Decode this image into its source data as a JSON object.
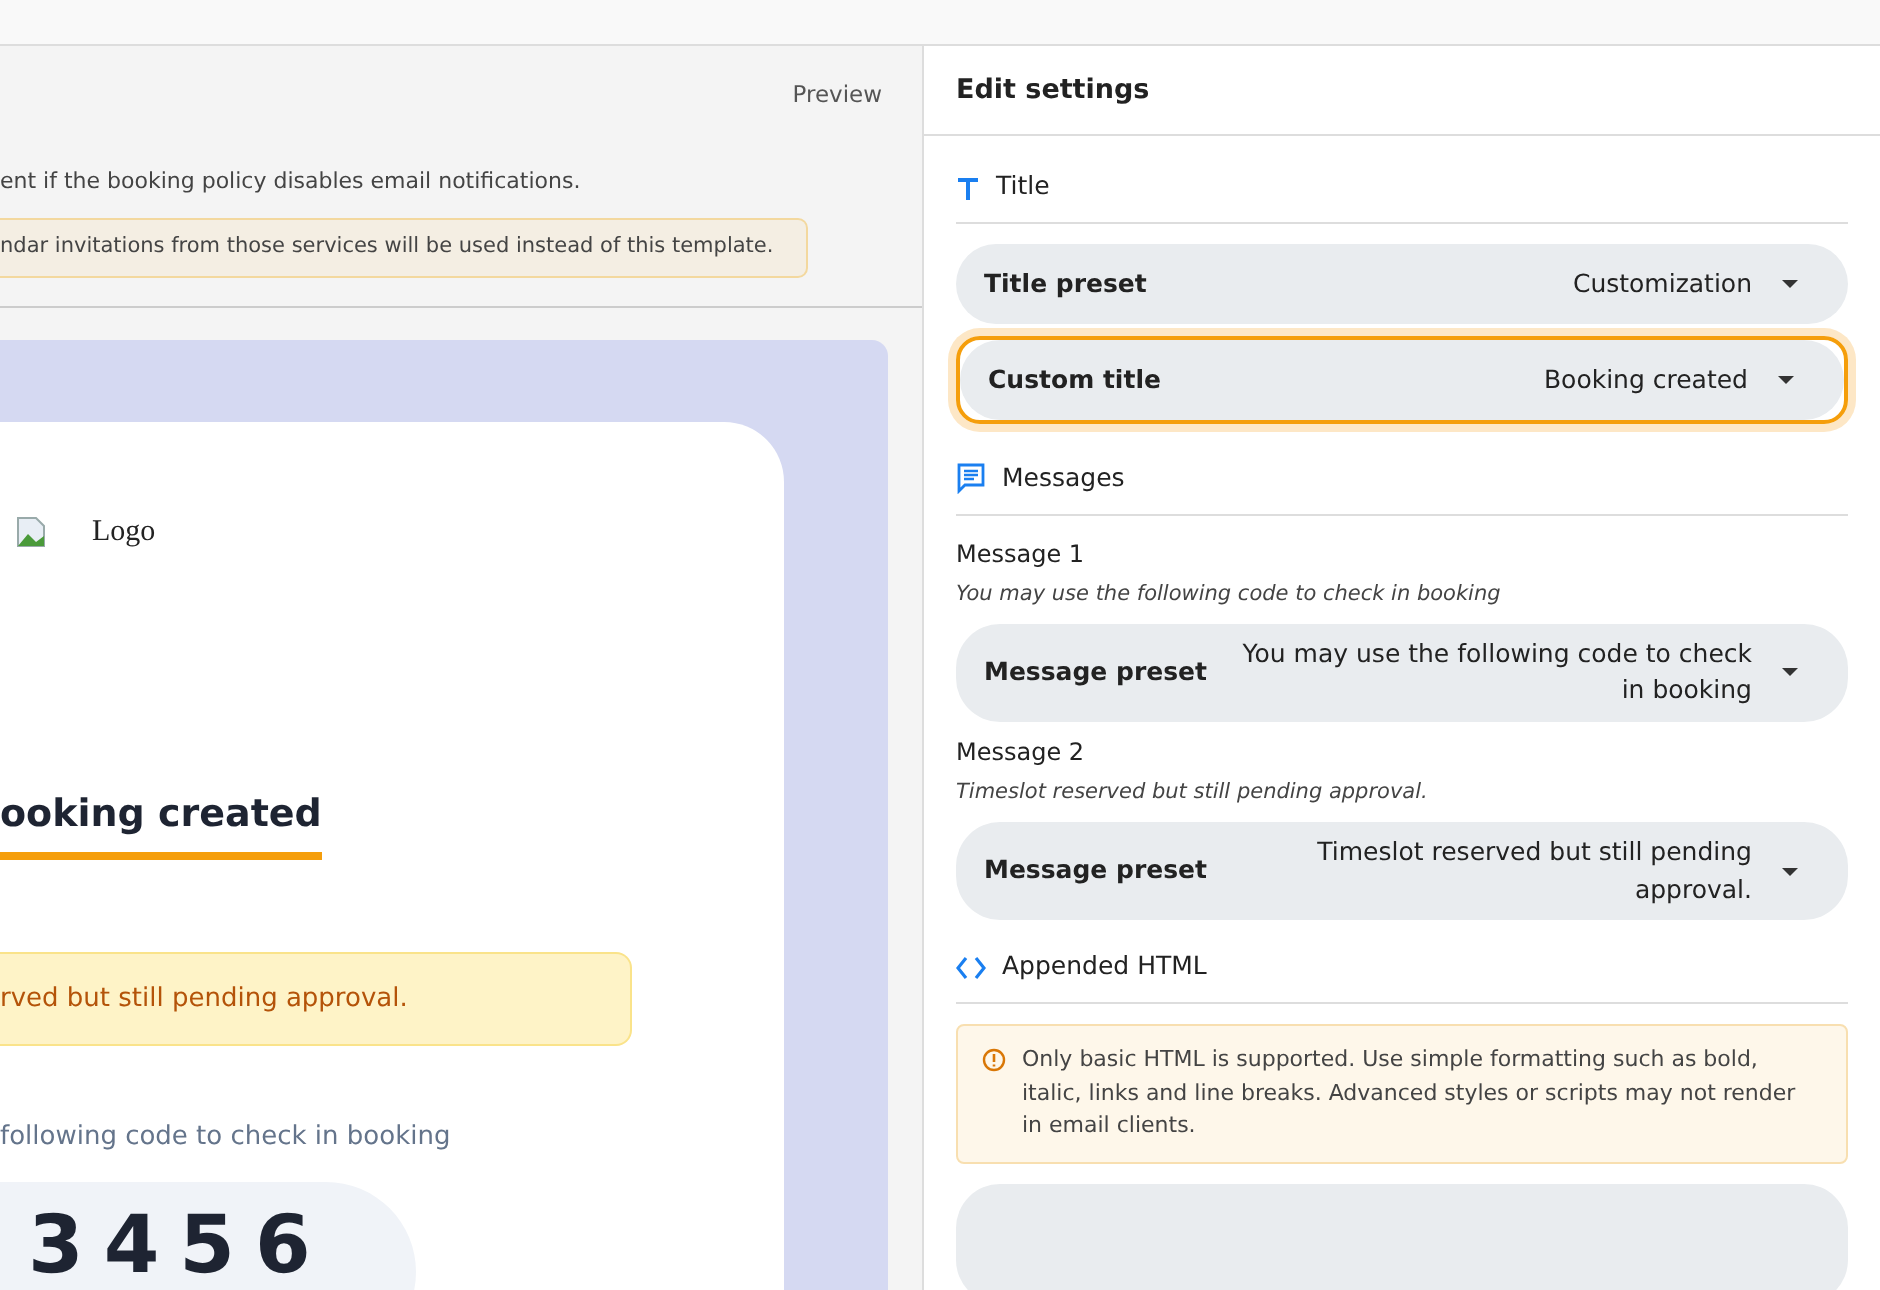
{
  "preview_pane": {
    "preview_label": "Preview",
    "notice": "ent if the booking policy disables email notifications.",
    "warning": "ndar invitations from those services will be used instead of this template.",
    "email": {
      "logo_alt": "Logo",
      "heading": "ooking created",
      "alert": "rved but still pending approval.",
      "code_caption": "following code to check in booking",
      "code": "3456"
    }
  },
  "settings": {
    "title": "Edit settings",
    "sections": [
      {
        "kind": "title",
        "heading": "Title",
        "items": [
          {
            "kind": "select",
            "label": "Title preset",
            "value": "Customization",
            "focused": false
          },
          {
            "kind": "select",
            "label": "Custom title",
            "value": "Booking created",
            "focused": true
          }
        ]
      },
      {
        "kind": "messages",
        "heading": "Messages",
        "items": [
          {
            "kind": "caption",
            "label": "Message 1",
            "hint": "You may use the following code to check in booking"
          },
          {
            "kind": "select",
            "label": "Message preset",
            "value": "You may use the following code to check in booking",
            "focused": false
          },
          {
            "kind": "caption",
            "label": "Message 2",
            "hint": "Timeslot reserved but still pending approval."
          },
          {
            "kind": "select",
            "label": "Message preset",
            "value": "Timeslot reserved but still pending approval.",
            "focused": false
          }
        ]
      },
      {
        "kind": "html",
        "heading": "Appended HTML",
        "items": [
          {
            "kind": "note",
            "text": "Only basic HTML is supported. Use simple formatting such as bold, italic, links and line breaks. Advanced styles or scripts may not render in email clients."
          },
          {
            "kind": "editor"
          }
        ]
      }
    ]
  }
}
